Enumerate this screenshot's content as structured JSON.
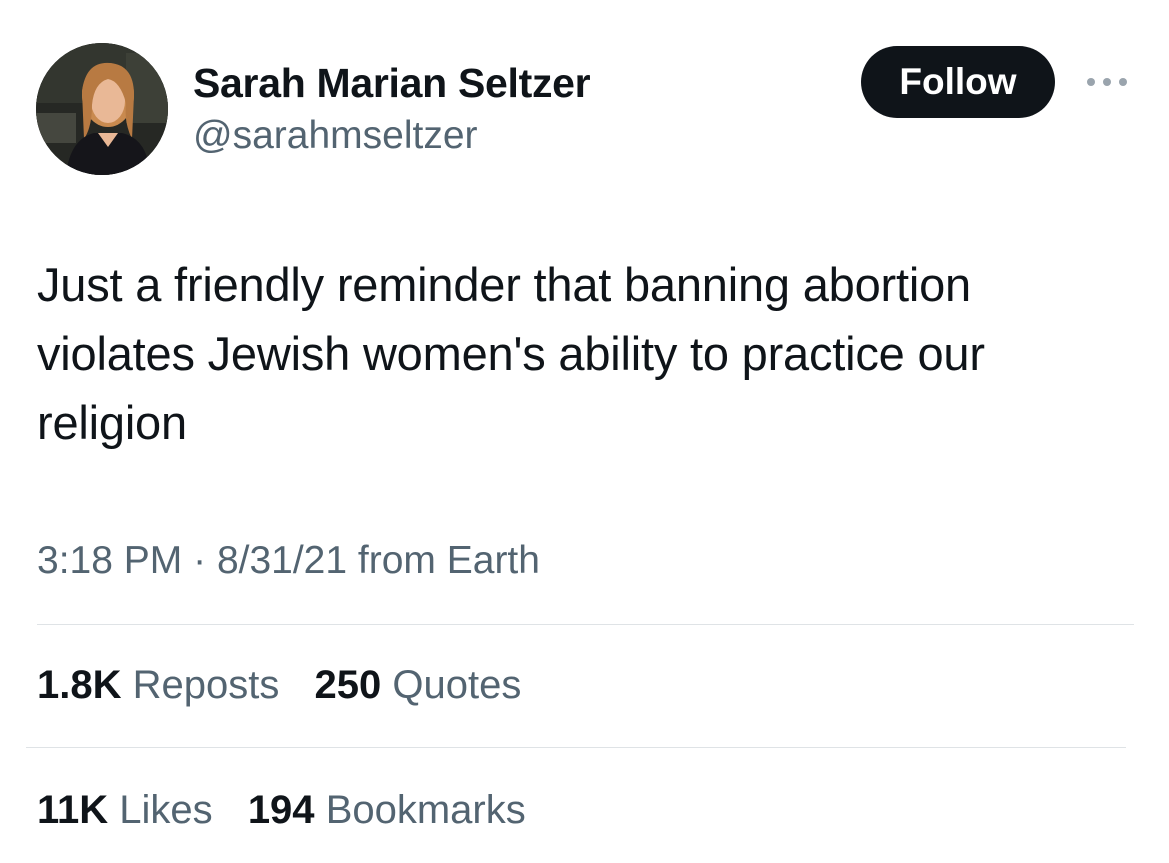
{
  "author": {
    "name": "Sarah Marian Seltzer",
    "handle": "@sarahmseltzer"
  },
  "follow_button": {
    "label": "Follow"
  },
  "tweet": {
    "text": "Just a friendly reminder that banning abortion violates Jewish women's ability to practice our religion",
    "time": "3:18 PM",
    "separator": "·",
    "date": "8/31/21",
    "source": "from Earth"
  },
  "stats": {
    "reposts": {
      "value": "1.8K",
      "label": "Reposts"
    },
    "quotes": {
      "value": "250",
      "label": "Quotes"
    },
    "likes": {
      "value": "11K",
      "label": "Likes"
    },
    "bookmarks": {
      "value": "194",
      "label": "Bookmarks"
    }
  },
  "icons": {
    "avatar": "profile-photo",
    "more": "more-dots-icon"
  },
  "colors": {
    "text_primary": "#0f1419",
    "text_secondary": "#536471",
    "follow_button_bg": "#0f1419",
    "divider": "#dfe3e6"
  }
}
